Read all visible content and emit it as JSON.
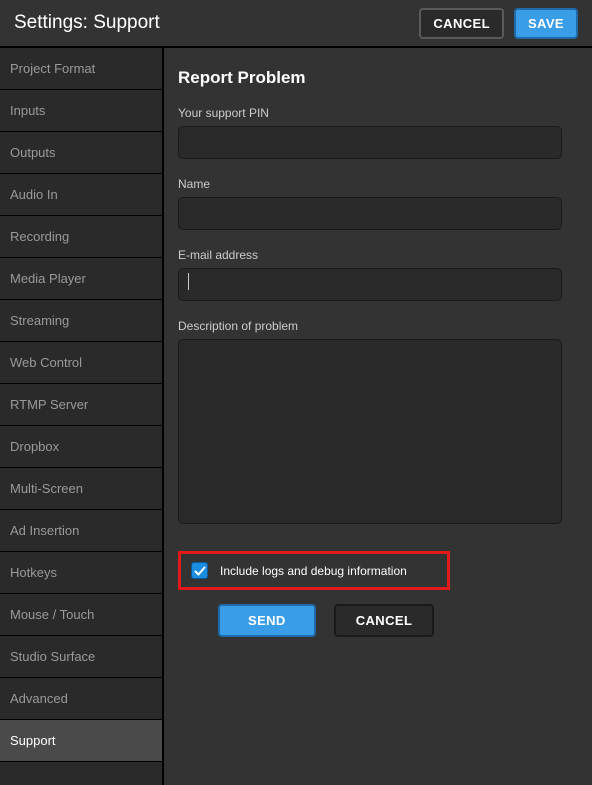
{
  "header": {
    "title": "Settings: Support",
    "cancel_label": "CANCEL",
    "save_label": "SAVE"
  },
  "sidebar": {
    "items": [
      {
        "label": "Project Format",
        "active": false
      },
      {
        "label": "Inputs",
        "active": false
      },
      {
        "label": "Outputs",
        "active": false
      },
      {
        "label": "Audio In",
        "active": false
      },
      {
        "label": "Recording",
        "active": false
      },
      {
        "label": "Media Player",
        "active": false
      },
      {
        "label": "Streaming",
        "active": false
      },
      {
        "label": "Web Control",
        "active": false
      },
      {
        "label": "RTMP Server",
        "active": false
      },
      {
        "label": "Dropbox",
        "active": false
      },
      {
        "label": "Multi-Screen",
        "active": false
      },
      {
        "label": "Ad Insertion",
        "active": false
      },
      {
        "label": "Hotkeys",
        "active": false
      },
      {
        "label": "Mouse / Touch",
        "active": false
      },
      {
        "label": "Studio Surface",
        "active": false
      },
      {
        "label": "Advanced",
        "active": false
      },
      {
        "label": "Support",
        "active": true
      }
    ]
  },
  "form": {
    "title": "Report Problem",
    "pin_label": "Your support PIN",
    "pin_value": "",
    "name_label": "Name",
    "name_value": "",
    "email_label": "E-mail address",
    "email_value": "",
    "description_label": "Description of problem",
    "description_value": "",
    "include_logs_label": "Include logs and debug information",
    "include_logs_checked": true,
    "send_label": "SEND",
    "cancel_label": "CANCEL"
  },
  "colors": {
    "accent": "#3a9de8",
    "highlight": "#e21a1a",
    "bg": "#333333"
  }
}
